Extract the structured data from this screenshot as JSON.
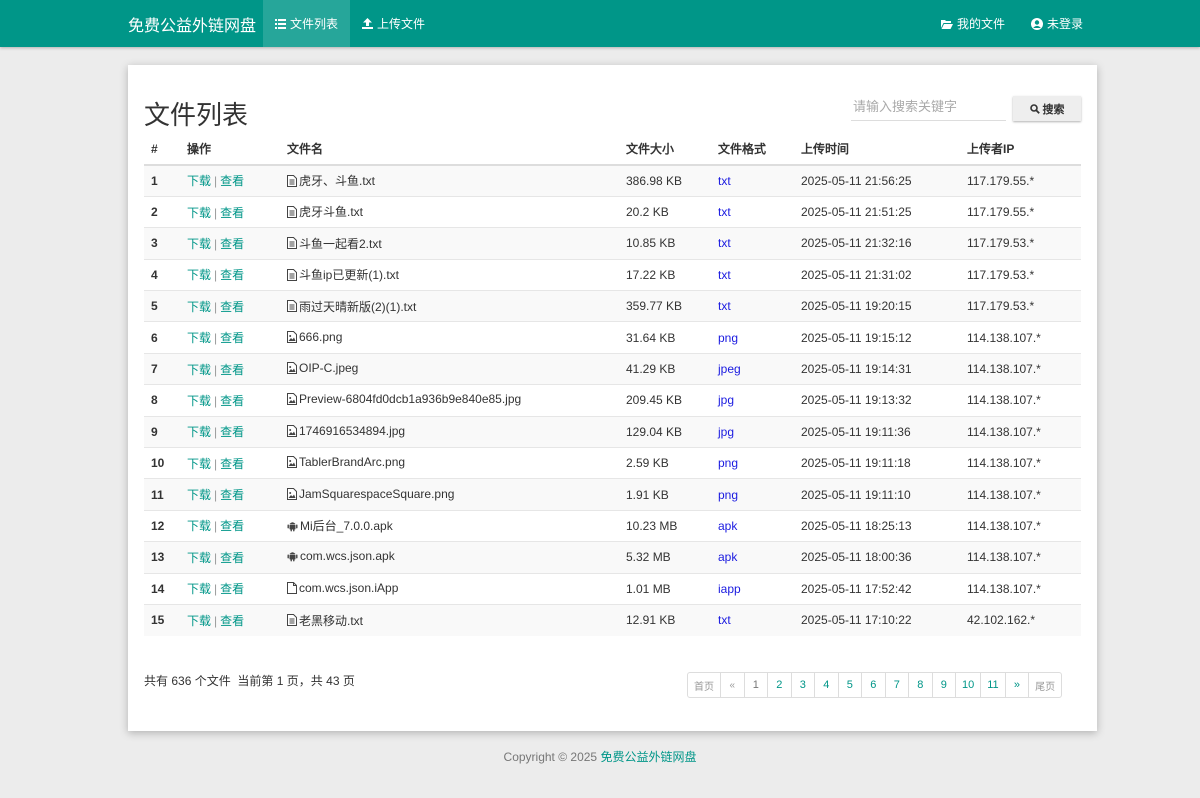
{
  "nav": {
    "brand": "免费公益外链网盘",
    "items": [
      {
        "label": "文件列表",
        "icon": "list-icon",
        "active": true
      },
      {
        "label": "上传文件",
        "icon": "upload-icon",
        "active": false
      }
    ],
    "right": [
      {
        "label": "我的文件",
        "icon": "folder-open-icon"
      },
      {
        "label": "未登录",
        "icon": "user-circle-icon"
      }
    ]
  },
  "page_title": "文件列表",
  "search": {
    "placeholder": "请输入搜索关键字",
    "value": "",
    "button_label": "搜索"
  },
  "table": {
    "columns": [
      "#",
      "操作",
      "文件名",
      "文件大小",
      "文件格式",
      "上传时间",
      "上传者IP"
    ],
    "action_download": "下载",
    "action_view": "查看",
    "rows": [
      {
        "n": "1",
        "name": "虎牙、斗鱼.txt",
        "icon": "file-text-icon",
        "size": "386.98 KB",
        "fmt": "txt",
        "time": "2025-05-11 21:56:25",
        "ip": "117.179.55.*"
      },
      {
        "n": "2",
        "name": "虎牙斗鱼.txt",
        "icon": "file-text-icon",
        "size": "20.2 KB",
        "fmt": "txt",
        "time": "2025-05-11 21:51:25",
        "ip": "117.179.55.*"
      },
      {
        "n": "3",
        "name": "斗鱼一起看2.txt",
        "icon": "file-text-icon",
        "size": "10.85 KB",
        "fmt": "txt",
        "time": "2025-05-11 21:32:16",
        "ip": "117.179.53.*"
      },
      {
        "n": "4",
        "name": "斗鱼ip已更新(1).txt",
        "icon": "file-text-icon",
        "size": "17.22 KB",
        "fmt": "txt",
        "time": "2025-05-11 21:31:02",
        "ip": "117.179.53.*"
      },
      {
        "n": "5",
        "name": "雨过天晴新版(2)(1).txt",
        "icon": "file-text-icon",
        "size": "359.77 KB",
        "fmt": "txt",
        "time": "2025-05-11 19:20:15",
        "ip": "117.179.53.*"
      },
      {
        "n": "6",
        "name": "666.png",
        "icon": "file-image-icon",
        "size": "31.64 KB",
        "fmt": "png",
        "time": "2025-05-11 19:15:12",
        "ip": "114.138.107.*"
      },
      {
        "n": "7",
        "name": "OIP-C.jpeg",
        "icon": "file-image-icon",
        "size": "41.29 KB",
        "fmt": "jpeg",
        "time": "2025-05-11 19:14:31",
        "ip": "114.138.107.*"
      },
      {
        "n": "8",
        "name": "Preview-6804fd0dcb1a936b9e840e85.jpg",
        "icon": "file-image-icon",
        "size": "209.45 KB",
        "fmt": "jpg",
        "time": "2025-05-11 19:13:32",
        "ip": "114.138.107.*"
      },
      {
        "n": "9",
        "name": "1746916534894.jpg",
        "icon": "file-image-icon",
        "size": "129.04 KB",
        "fmt": "jpg",
        "time": "2025-05-11 19:11:36",
        "ip": "114.138.107.*"
      },
      {
        "n": "10",
        "name": "TablerBrandArc.png",
        "icon": "file-image-icon",
        "size": "2.59 KB",
        "fmt": "png",
        "time": "2025-05-11 19:11:18",
        "ip": "114.138.107.*"
      },
      {
        "n": "11",
        "name": "JamSquarespaceSquare.png",
        "icon": "file-image-icon",
        "size": "1.91 KB",
        "fmt": "png",
        "time": "2025-05-11 19:11:10",
        "ip": "114.138.107.*"
      },
      {
        "n": "12",
        "name": "Mi后台_7.0.0.apk",
        "icon": "android-icon",
        "size": "10.23 MB",
        "fmt": "apk",
        "time": "2025-05-11 18:25:13",
        "ip": "114.138.107.*"
      },
      {
        "n": "13",
        "name": "com.wcs.json.apk",
        "icon": "android-icon",
        "size": "5.32 MB",
        "fmt": "apk",
        "time": "2025-05-11 18:00:36",
        "ip": "114.138.107.*"
      },
      {
        "n": "14",
        "name": "com.wcs.json.iApp",
        "icon": "file-icon",
        "size": "1.01 MB",
        "fmt": "iapp",
        "time": "2025-05-11 17:52:42",
        "ip": "114.138.107.*"
      },
      {
        "n": "15",
        "name": "老黑移动.txt",
        "icon": "file-text-icon",
        "size": "12.91 KB",
        "fmt": "txt",
        "time": "2025-05-11 17:10:22",
        "ip": "42.102.162.*"
      }
    ]
  },
  "summary": {
    "prefix": "共有",
    "total": "636",
    "mid1": "个文件  当前第",
    "current": "1",
    "mid2": "页，共",
    "pages": "43",
    "suffix": "页"
  },
  "pagination": [
    "首页",
    "«",
    "1",
    "2",
    "3",
    "4",
    "5",
    "6",
    "7",
    "8",
    "9",
    "10",
    "11",
    "»",
    "尾页"
  ],
  "footer": {
    "copyright": "Copyright © 2025",
    "link": "免费公益外链网盘"
  },
  "colors": {
    "primary": "#009688",
    "format_link": "#1a1ae0",
    "background": "#ececec"
  }
}
